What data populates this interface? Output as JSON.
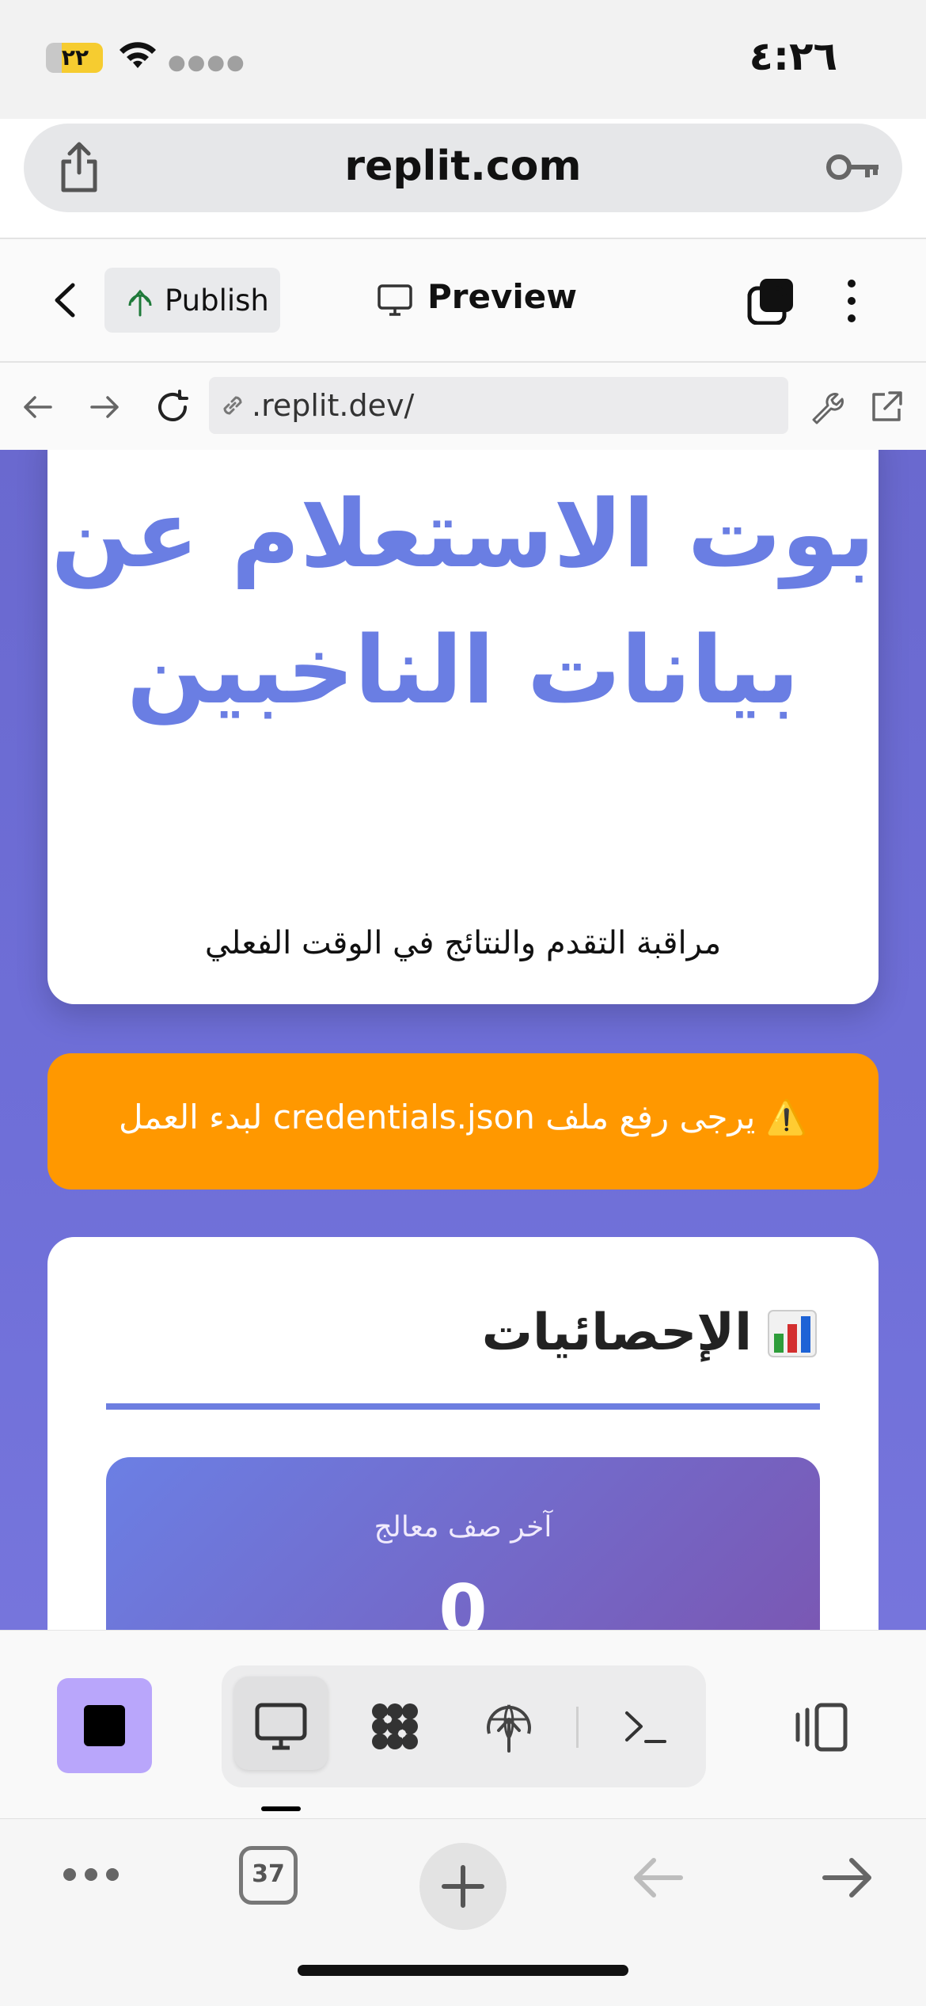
{
  "status_bar": {
    "time": "٤:٢٦",
    "battery": "٢٢"
  },
  "browser": {
    "domain": "replit.com"
  },
  "replit_header": {
    "publish_label": "Publish",
    "preview_label": "Preview"
  },
  "address_bar": {
    "url": ".replit.dev/"
  },
  "page": {
    "hero_title": "بوت الاستعلام عن بيانات الناخبين",
    "hero_subtitle": "مراقبة التقدم والنتائج في الوقت الفعلي",
    "alert_text": "⚠️ يرجى رفع ملف credentials.json لبدء العمل",
    "stats_title": "الإحصائيات",
    "stat_label": "آخر صف معالج",
    "stat_value": "0"
  },
  "safari_bottom": {
    "tab_count": "37"
  },
  "colors": {
    "accent_blue": "#6a7ee3",
    "alert_orange": "#ff9800",
    "stop_button": "#b9a6fb",
    "gradient_start": "#6b7fe4",
    "gradient_end": "#7b55b0"
  }
}
